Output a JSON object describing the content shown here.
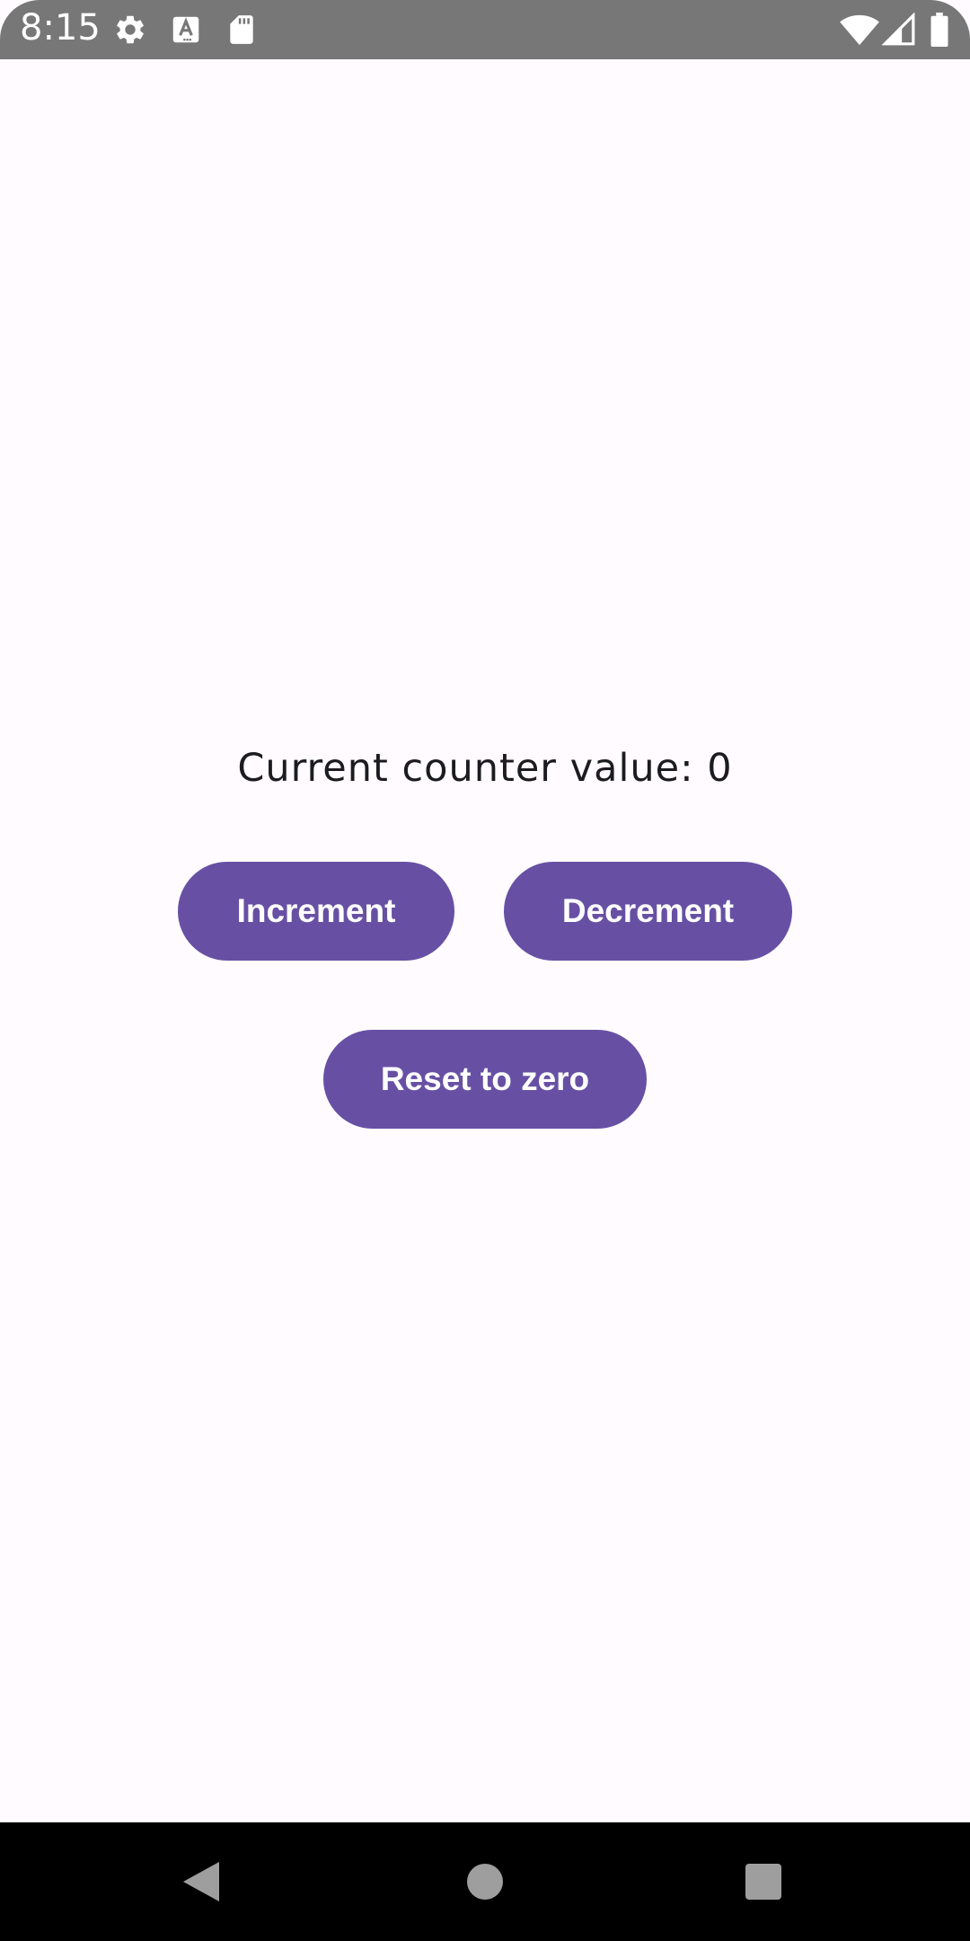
{
  "status_bar": {
    "time": "8:15",
    "icons": [
      "gear-icon",
      "font-a-icon",
      "sd-card-icon",
      "wifi-icon",
      "cellular-signal-icon",
      "battery-icon"
    ],
    "color": "#777777"
  },
  "main": {
    "counter_text": "Current counter value: 0",
    "counter_value": 0,
    "buttons": {
      "increment": "Increment",
      "decrement": "Decrement",
      "reset": "Reset to zero"
    },
    "button_color": "#6750a4",
    "background_color": "#fffbfe"
  },
  "nav_bar": {
    "icons": [
      "back-icon",
      "home-icon",
      "recents-icon"
    ],
    "color": "#000000"
  }
}
